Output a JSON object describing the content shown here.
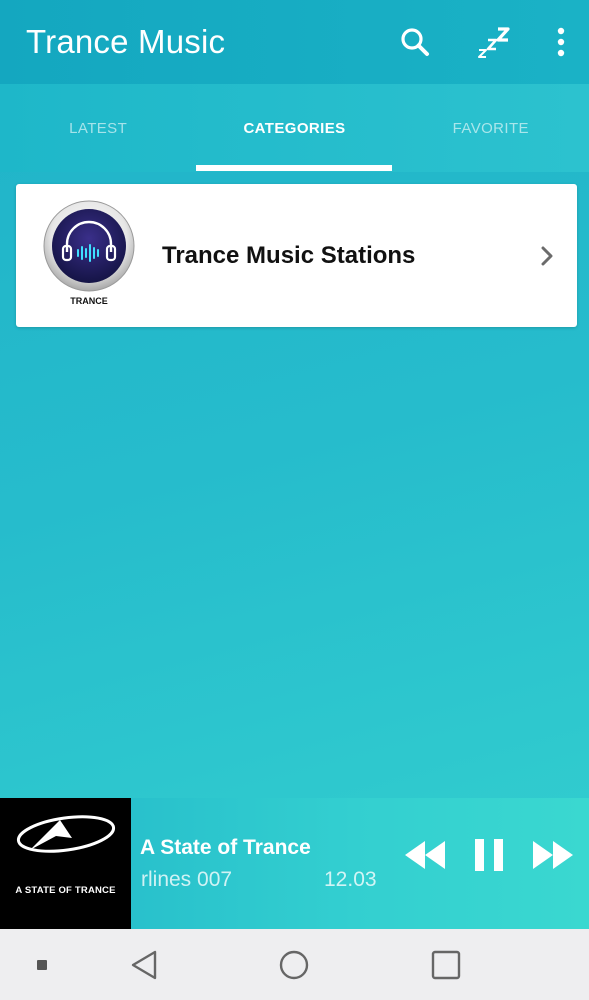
{
  "app": {
    "title": "Trance Music"
  },
  "header": {
    "actions": [
      {
        "icon": "search-icon"
      },
      {
        "icon": "sleep-timer-icon"
      },
      {
        "icon": "more-vert-icon"
      }
    ]
  },
  "tabs": [
    {
      "label": "LATEST",
      "active": false
    },
    {
      "label": "CATEGORIES",
      "active": true
    },
    {
      "label": "FAVORITE",
      "active": false
    }
  ],
  "categories": [
    {
      "title": "Trance Music Stations",
      "thumb_label": "TRANCE",
      "icon": "headphones-icon"
    }
  ],
  "player": {
    "station": "A State of Trance",
    "artwork_caption": "A STATE OF TRANCE",
    "marquee_left": "rlines 007",
    "marquee_right": "12.03",
    "controls": [
      "rewind-icon",
      "pause-icon",
      "fast-forward-icon"
    ]
  },
  "navbar": {
    "items": [
      "menu-dot-icon",
      "back-icon",
      "home-icon",
      "recents-icon"
    ]
  },
  "colors": {
    "accent": "#1ab2c6",
    "background_start": "#1fb2c8",
    "background_end": "#35d2d0",
    "card": "#ffffff"
  }
}
